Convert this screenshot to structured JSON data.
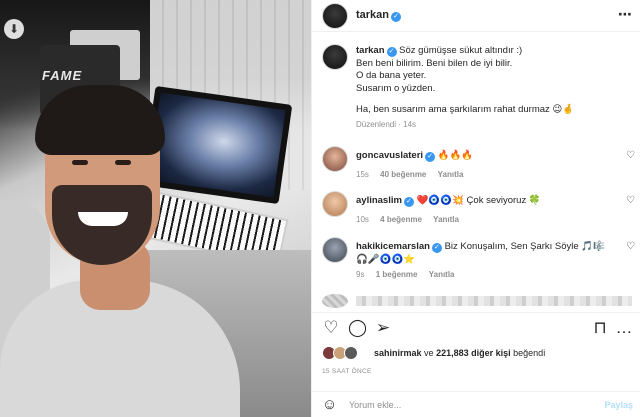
{
  "post": {
    "author": "tarkan",
    "header_more_icon": "more-horizontal-icon",
    "download_icon": "download-icon"
  },
  "caption": {
    "username": "tarkan",
    "line1": "Söz gümüşse sükut altındır :)",
    "line2": "Ben beni bilirim. Beni bilen de iyi bilir.",
    "line3": "O da bana yeter.",
    "line4": "Susarım o yüzden.",
    "line5": "Ha, ben susarım ama şarkılarım rahat durmaz 😉🤞",
    "edited": "Düzenlendi",
    "time": "14s"
  },
  "comments": [
    {
      "username": "goncavuslateri",
      "text": "🔥🔥🔥",
      "time": "15s",
      "likes": "40 beğenme",
      "reply": "Yanıtla"
    },
    {
      "username": "aylinaslim",
      "text": "❤️🧿🧿💥 Çok seviyoruz 🍀",
      "time": "10s",
      "likes": "4 beğenme",
      "reply": "Yanıtla"
    },
    {
      "username": "hakikicemarslan",
      "text": "Biz Konuşalım, Sen Şarkı Söyle 🎵🎼🎧🎤🧿🧿⭐",
      "time": "9s",
      "likes": "1 beğenme",
      "reply": "Yanıtla"
    }
  ],
  "likes": {
    "user": "sahinirmak",
    "connector": "ve",
    "count": "221,883 diğer kişi",
    "suffix": "beğendi"
  },
  "timestamp": "15 SAAT ÖNCE",
  "add_comment": {
    "placeholder": "Yorum ekle...",
    "post_label": "Paylaş"
  },
  "colors": {
    "verified": "#3897f0",
    "meta_gray": "#8e8e8e",
    "post_disabled": "#b2dffc"
  }
}
